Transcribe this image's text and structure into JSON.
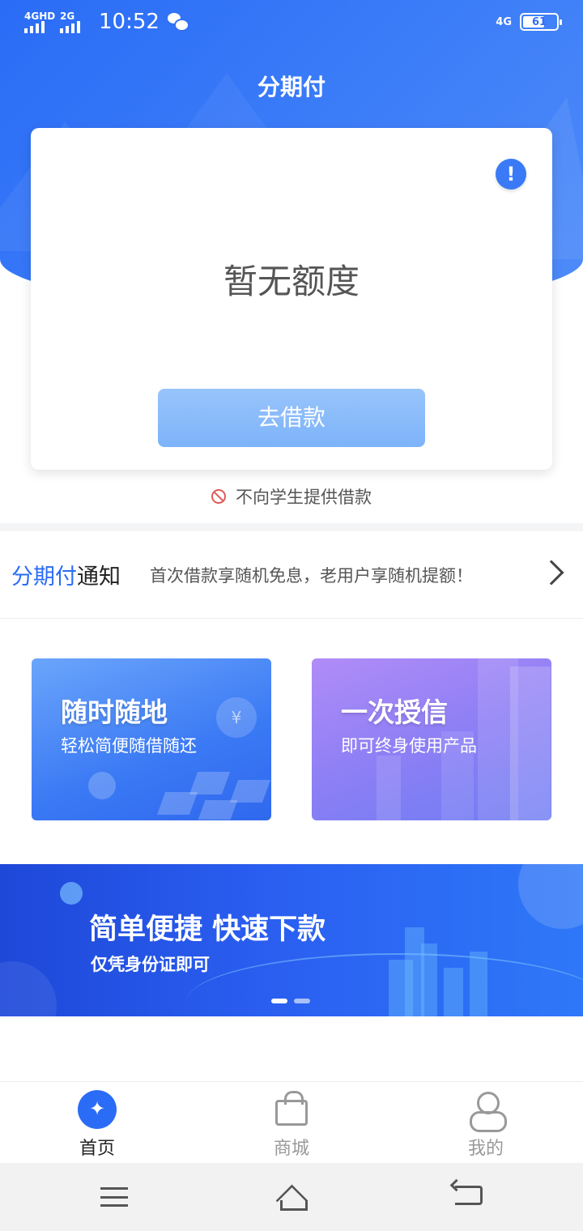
{
  "status_bar": {
    "network_1": "4GHD",
    "network_2": "2G",
    "time": "10:52",
    "network_right": "4G",
    "battery": "61"
  },
  "header": {
    "title": "分期付"
  },
  "credit_card": {
    "status_text": "暂无额度",
    "button_label": "去借款"
  },
  "student_note": "不向学生提供借款",
  "notice": {
    "title_highlight": "分期付",
    "title_rest": "通知",
    "text": "首次借款享随机免息，老用户享随机提额！"
  },
  "features": [
    {
      "title": "随时随地",
      "subtitle": "轻松简便随借随还"
    },
    {
      "title": "一次授信",
      "subtitle": "即可终身使用产品"
    }
  ],
  "banner": {
    "title": "简单便捷 快速下款",
    "subtitle": "仅凭身份证即可"
  },
  "tabbar": {
    "items": [
      {
        "label": "首页",
        "icon": "home-icon",
        "active": true
      },
      {
        "label": "商城",
        "icon": "shopping-bag-icon",
        "active": false
      },
      {
        "label": "我的",
        "icon": "user-icon",
        "active": false
      }
    ]
  },
  "colors": {
    "primary": "#2a6cf6",
    "button": "#7db3fa",
    "feature_blue": "#3a79f4",
    "feature_purple": "#8e7ff5",
    "banner": "#2a5ef0"
  }
}
